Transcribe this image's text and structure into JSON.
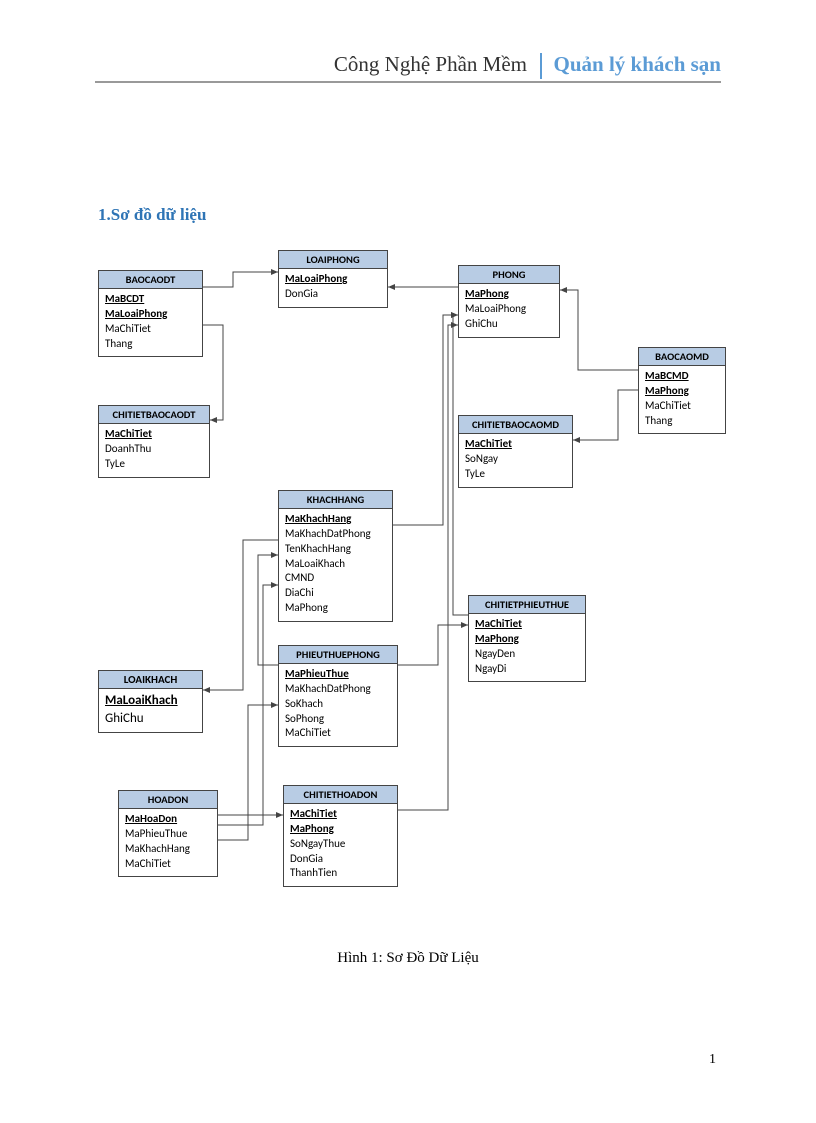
{
  "header": {
    "left": "Công Nghệ Phần Mềm",
    "right": "Quản lý khách sạn"
  },
  "section_title": "1.Sơ đồ dữ liệu",
  "caption": "Hình 1: Sơ Đồ Dữ Liệu",
  "page_number": "1",
  "entities": {
    "baocaodt": {
      "title": "BAOCAODT",
      "fields": [
        {
          "name": "MaBCDT",
          "pk": true
        },
        {
          "name": "MaLoaiPhong",
          "pk": true
        },
        {
          "name": "MaChiTiet",
          "pk": false
        },
        {
          "name": "Thang",
          "pk": false
        }
      ]
    },
    "loaiphong": {
      "title": "LOAIPHONG",
      "fields": [
        {
          "name": "MaLoaiPhong",
          "pk": true
        },
        {
          "name": "DonGia",
          "pk": false
        }
      ]
    },
    "phong": {
      "title": "PHONG",
      "fields": [
        {
          "name": "MaPhong",
          "pk": true
        },
        {
          "name": "MaLoaiPhong",
          "pk": false
        },
        {
          "name": "GhiChu",
          "pk": false
        }
      ]
    },
    "baocaomd": {
      "title": "BAOCAOMD",
      "fields": [
        {
          "name": "MaBCMD",
          "pk": true
        },
        {
          "name": "MaPhong",
          "pk": true
        },
        {
          "name": "MaChiTiet",
          "pk": false
        },
        {
          "name": "Thang",
          "pk": false
        }
      ]
    },
    "chitietbaocaodt": {
      "title": "CHITIETBAOCAODT",
      "fields": [
        {
          "name": "MaChiTiet",
          "pk": true
        },
        {
          "name": "DoanhThu",
          "pk": false
        },
        {
          "name": "TyLe",
          "pk": false
        }
      ]
    },
    "chitietbaocaomd": {
      "title": "CHITIETBAOCAOMD",
      "fields": [
        {
          "name": "MaChiTiet",
          "pk": true
        },
        {
          "name": "SoNgay",
          "pk": false
        },
        {
          "name": "TyLe",
          "pk": false
        }
      ]
    },
    "khachhang": {
      "title": "KHACHHANG",
      "fields": [
        {
          "name": "MaKhachHang",
          "pk": true
        },
        {
          "name": "MaKhachDatPhong",
          "pk": false
        },
        {
          "name": "TenKhachHang",
          "pk": false
        },
        {
          "name": "MaLoaiKhach",
          "pk": false
        },
        {
          "name": "CMND",
          "pk": false
        },
        {
          "name": "DiaChi",
          "pk": false
        },
        {
          "name": "MaPhong",
          "pk": false
        }
      ]
    },
    "chitietphieuthue": {
      "title": "CHITIETPHIEUTHUE",
      "fields": [
        {
          "name": "MaChiTiet",
          "pk": true
        },
        {
          "name": "MaPhong",
          "pk": true
        },
        {
          "name": "NgayDen",
          "pk": false
        },
        {
          "name": "NgayDi",
          "pk": false
        }
      ]
    },
    "loaikhach": {
      "title": "LOAIKHACH",
      "fields": [
        {
          "name": "MaLoaiKhach",
          "pk": true
        },
        {
          "name": "GhiChu",
          "pk": false
        }
      ]
    },
    "phieuthuephong": {
      "title": "PHIEUTHUEPHONG",
      "fields": [
        {
          "name": "MaPhieuThue",
          "pk": true
        },
        {
          "name": "MaKhachDatPhong",
          "pk": false
        },
        {
          "name": "SoKhach",
          "pk": false
        },
        {
          "name": "SoPhong",
          "pk": false
        },
        {
          "name": "MaChiTiet",
          "pk": false
        }
      ]
    },
    "hoadon": {
      "title": "HOADON",
      "fields": [
        {
          "name": "MaHoaDon",
          "pk": true
        },
        {
          "name": "MaPhieuThue",
          "pk": false
        },
        {
          "name": "MaKhachHang",
          "pk": false
        },
        {
          "name": "MaChiTiet",
          "pk": false
        }
      ]
    },
    "chitiethoadon": {
      "title": "CHITIETHOADON",
      "fields": [
        {
          "name": "MaChiTiet",
          "pk": true
        },
        {
          "name": "MaPhong",
          "pk": true
        },
        {
          "name": "SoNgayThue",
          "pk": false
        },
        {
          "name": "DonGia",
          "pk": false
        },
        {
          "name": "ThanhTien",
          "pk": false
        }
      ]
    }
  }
}
